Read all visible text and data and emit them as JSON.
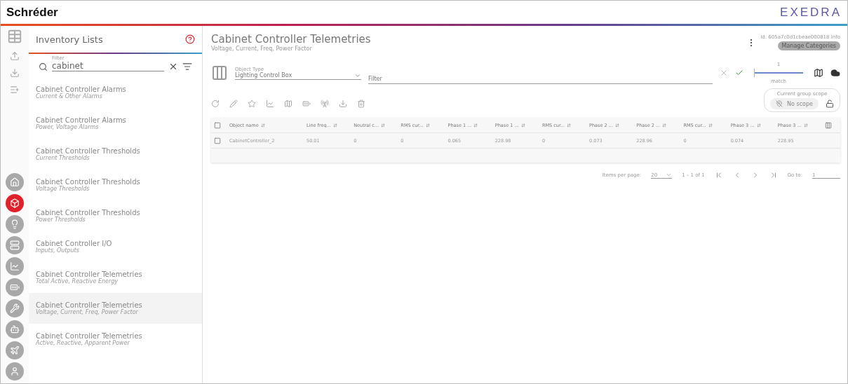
{
  "header": {
    "brand": "Schréder",
    "product": "EXEDRA"
  },
  "rail": {
    "tools": [
      {
        "kind": "table"
      },
      {
        "kind": "upload"
      },
      {
        "kind": "download"
      },
      {
        "kind": "list-add"
      }
    ],
    "apps": [
      {
        "kind": "home",
        "selected": false
      },
      {
        "kind": "cabinet",
        "selected": true
      },
      {
        "kind": "bulb",
        "selected": false
      },
      {
        "kind": "panel",
        "selected": false
      },
      {
        "kind": "chart",
        "selected": false
      },
      {
        "kind": "battery",
        "selected": false
      },
      {
        "kind": "wrench",
        "selected": false
      },
      {
        "kind": "arm",
        "selected": false
      },
      {
        "kind": "drone",
        "selected": false
      },
      {
        "kind": "user",
        "selected": false
      }
    ]
  },
  "sidebar": {
    "title": "Inventory Lists",
    "filter": {
      "label": "Filter",
      "value": "cabinet"
    },
    "items": [
      {
        "title": "Cabinet Controller Alarms",
        "subtitle": "Current & Other Alarms",
        "selected": false
      },
      {
        "title": "Cabinet Controller Alarms",
        "subtitle": "Power, Voltage Alarms",
        "selected": false
      },
      {
        "title": "Cabinet Controller Thresholds",
        "subtitle": "Current Thresholds",
        "selected": false
      },
      {
        "title": "Cabinet Controller Thresholds",
        "subtitle": "Voltage Thresholds",
        "selected": false
      },
      {
        "title": "Cabinet Controller Thresholds",
        "subtitle": "Power Thresholds",
        "selected": false
      },
      {
        "title": "Cabinet Controller I/O",
        "subtitle": "Inputs, Outputs",
        "selected": false
      },
      {
        "title": "Cabinet Controller Telemetries",
        "subtitle": "Total Active, Reactive Energy",
        "selected": false
      },
      {
        "title": "Cabinet Controller Telemetries",
        "subtitle": "Voltage, Current, Freq, Power Factor",
        "selected": true
      },
      {
        "title": "Cabinet Controller Telemetries",
        "subtitle": "Active, Reactive, Apparent Power",
        "selected": false
      }
    ]
  },
  "main": {
    "title": "Cabinet Controller Telemetries",
    "subtitle": "Voltage, Current, Freq, Power Factor",
    "id_text": "Id: 605a7c0d1cbeae000818 Info",
    "manage_button": "Manage Categories",
    "object_type": {
      "label": "Object Type",
      "value": "Lighting Control Box"
    },
    "filter": {
      "placeholder": "Filter"
    },
    "match": {
      "value": "1",
      "label": "match",
      "level": 1
    },
    "scope": {
      "label": "Current group scope",
      "value": "No scope"
    },
    "toolbar": [
      {
        "kind": "refresh"
      },
      {
        "kind": "edit"
      },
      {
        "kind": "star"
      },
      {
        "kind": "chart"
      },
      {
        "kind": "map"
      },
      {
        "kind": "battery"
      },
      {
        "kind": "tower"
      },
      {
        "kind": "download"
      },
      {
        "kind": "delete"
      }
    ],
    "table": {
      "header_checked": false,
      "columns": [
        "Object name",
        "Line freq...",
        "Neutral c...",
        "RMS cur...",
        "Phase 1 ...",
        "Phase 1 ...",
        "RMS cur...",
        "Phase 2 ...",
        "Phase 2 ...",
        "RMS cur...",
        "Phase 3 ...",
        "Phase 3 ..."
      ],
      "rows": [
        {
          "checked": false,
          "cells": [
            "CabinetController_2",
            "50.01",
            "0",
            "0",
            "0.065",
            "228.98",
            "0",
            "0.073",
            "228.96",
            "0",
            "0.074",
            "228.95"
          ]
        }
      ]
    },
    "pagination": {
      "items_label": "Items per page:",
      "page_size": "20",
      "range": "1 – 1 of 1",
      "goto_label": "Go to:",
      "goto_value": "1"
    }
  }
}
